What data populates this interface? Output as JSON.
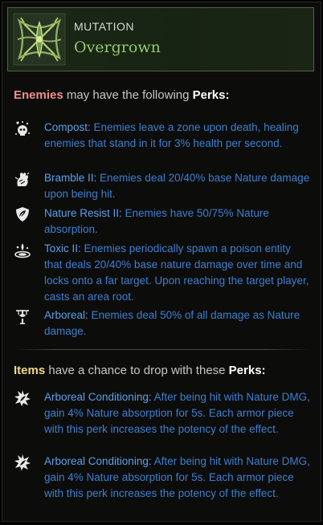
{
  "header": {
    "label": "MUTATION",
    "name": "Overgrown"
  },
  "enemies_section": {
    "word": "Enemies",
    "middle": " may have the following ",
    "perks_word": "Perks:"
  },
  "enemy_perks": [
    {
      "icon": "skull-zone-icon",
      "name": "Compost:",
      "description": " Enemies leave a zone upon death, healing enemies that stand in it for 3% health per second."
    },
    {
      "icon": "thorn-fist-icon",
      "name": "Bramble II:",
      "description": " Enemies deal 20/40% base Nature damage upon being hit."
    },
    {
      "icon": "leaf-shield-icon",
      "name": "Nature Resist II:",
      "description": " Enemies have 50/75% Nature absorption."
    },
    {
      "icon": "poison-pool-icon",
      "name": "Toxic II:",
      "description": " Enemies periodically spawn a poison entity that deals 20/40% base nature damage over time and locks onto a far target. Upon reaching the target player, casts an area root."
    },
    {
      "icon": "tree-sword-icon",
      "name": "Arboreal:",
      "description": " Enemies deal 50% of all damage as Nature damage."
    }
  ],
  "items_section": {
    "word": "Items",
    "middle": " have a chance to drop with these ",
    "perks_word": "Perks:"
  },
  "item_perks": [
    {
      "icon": "burst-perk-icon",
      "name": "Arboreal Conditioning:",
      "description": " After being hit with Nature DMG, gain 4% Nature absorption for 5s. Each armor piece with this perk increases the potency of the effect."
    },
    {
      "icon": "burst-perk-icon",
      "name": "Arboreal Conditioning:",
      "description": " After being hit with Nature DMG, gain 4% Nature absorption for 5s. Each armor piece with this perk increases the potency of the effect."
    }
  ],
  "colors": {
    "perk_name": "#5aa0ec",
    "perk_text": "#3d7fd0",
    "enemies_word": "#ef8e8e",
    "items_word": "#f3d98a",
    "mutation_name": "#93c76c"
  }
}
